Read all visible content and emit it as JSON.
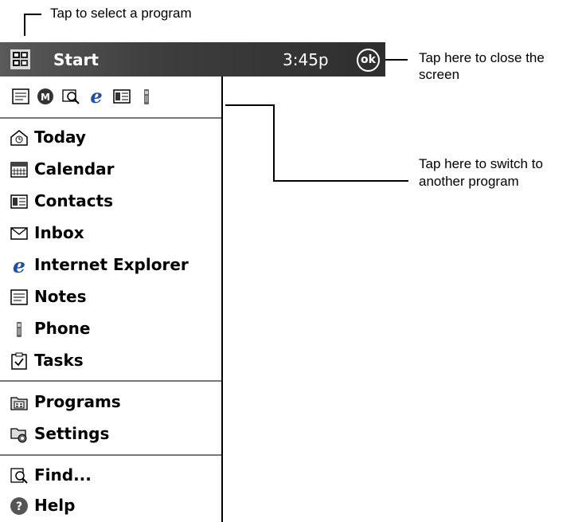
{
  "callouts": {
    "select_program": "Tap to select a program",
    "close_line1": "Tap here to close the",
    "close_line2": "screen",
    "switch_line1": "Tap here to switch to",
    "switch_line2": "another program"
  },
  "taskbar": {
    "start_label": "Start",
    "clock": "3:45p",
    "ok_label": "ok"
  },
  "quickbar": {
    "icons": [
      "notes-icon",
      "msn-messenger-icon",
      "search-icon",
      "internet-explorer-icon",
      "contacts-icon",
      "phone-icon"
    ]
  },
  "menu": {
    "programs": [
      {
        "label": "Today",
        "icon": "today-icon"
      },
      {
        "label": "Calendar",
        "icon": "calendar-icon"
      },
      {
        "label": "Contacts",
        "icon": "contacts-icon"
      },
      {
        "label": "Inbox",
        "icon": "inbox-icon"
      },
      {
        "label": "Internet Explorer",
        "icon": "internet-explorer-icon"
      },
      {
        "label": "Notes",
        "icon": "notes-icon"
      },
      {
        "label": "Phone",
        "icon": "phone-icon"
      },
      {
        "label": "Tasks",
        "icon": "tasks-icon"
      }
    ],
    "system": [
      {
        "label": "Programs",
        "icon": "programs-folder-icon"
      },
      {
        "label": "Settings",
        "icon": "settings-icon"
      }
    ],
    "utility": [
      {
        "label": "Find...",
        "icon": "find-icon"
      },
      {
        "label": "Help",
        "icon": "help-icon"
      }
    ]
  },
  "colors": {
    "taskbar_dark": "#2e2e2e",
    "taskbar_light": "#5a5a5a",
    "ie_blue": "#1e4fa8",
    "help_gray": "#555555"
  }
}
